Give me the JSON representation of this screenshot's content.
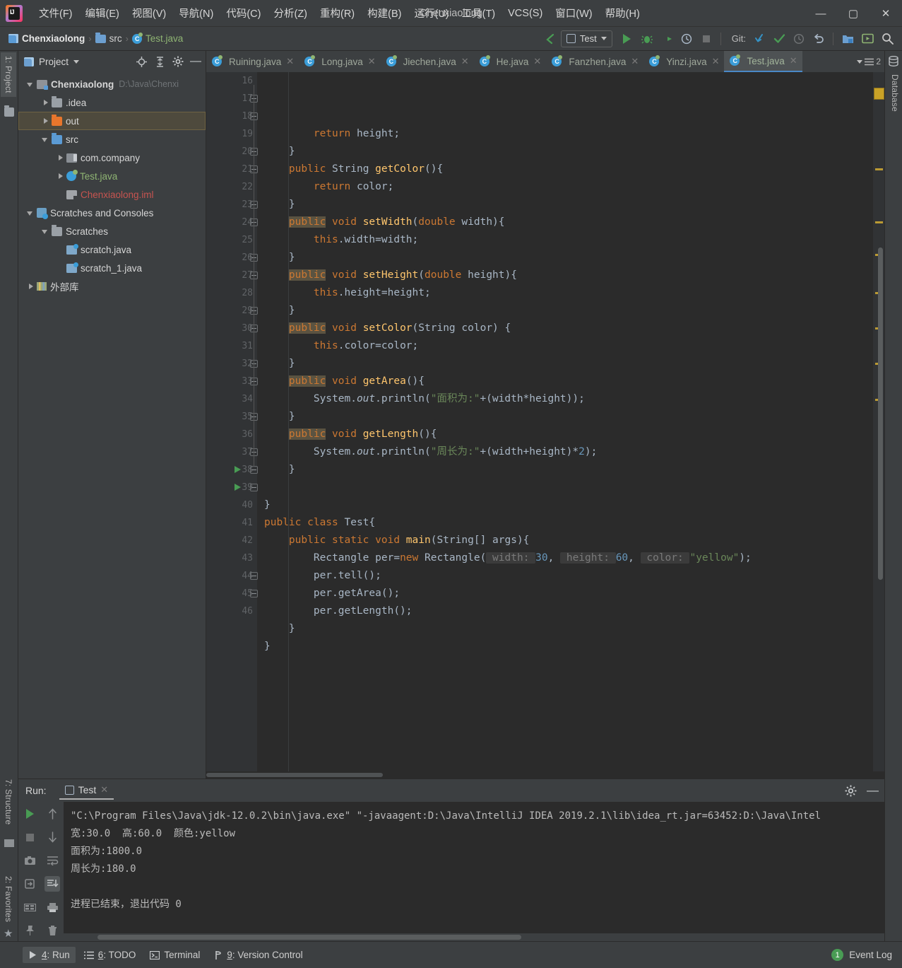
{
  "window": {
    "title": "Chenxiaolong",
    "minimize": "—",
    "maximize": "▢",
    "close": "✕"
  },
  "menu": {
    "items": [
      {
        "label": "文件(F)",
        "name": "menu-file"
      },
      {
        "label": "编辑(E)",
        "name": "menu-edit"
      },
      {
        "label": "视图(V)",
        "name": "menu-view"
      },
      {
        "label": "导航(N)",
        "name": "menu-navigate"
      },
      {
        "label": "代码(C)",
        "name": "menu-code"
      },
      {
        "label": "分析(Z)",
        "name": "menu-analyze"
      },
      {
        "label": "重构(R)",
        "name": "menu-refactor"
      },
      {
        "label": "构建(B)",
        "name": "menu-build"
      },
      {
        "label": "运行(U)",
        "name": "menu-run"
      },
      {
        "label": "工具(T)",
        "name": "menu-tools"
      },
      {
        "label": "VCS(S)",
        "name": "menu-vcs"
      },
      {
        "label": "窗口(W)",
        "name": "menu-window"
      },
      {
        "label": "帮助(H)",
        "name": "menu-help"
      }
    ]
  },
  "navbar": {
    "breadcrumb": [
      "Chenxiaolong",
      "src",
      "Test.java"
    ],
    "separator": "›",
    "run_config": "Test",
    "git_label": "Git:"
  },
  "left_strips": {
    "project": "1: Project",
    "structure": "7: Structure",
    "favorites": "2: Favorites"
  },
  "right_strips": {
    "database": "Database"
  },
  "project_panel": {
    "title": "Project",
    "tree": [
      {
        "label": "Chenxiaolong",
        "path": "D:\\Java\\Chenxi",
        "indent": 0,
        "arrow": "down",
        "icon": "module-icon",
        "bold": true
      },
      {
        "label": ".idea",
        "indent": 1,
        "arrow": "right",
        "icon": "folder-gray-icon"
      },
      {
        "label": "out",
        "indent": 1,
        "arrow": "right",
        "icon": "folder-orange-icon",
        "selected": true
      },
      {
        "label": "src",
        "indent": 1,
        "arrow": "down",
        "icon": "folder-blue-icon"
      },
      {
        "label": "com.company",
        "indent": 2,
        "arrow": "right",
        "icon": "package-icon"
      },
      {
        "label": "Test.java",
        "indent": 2,
        "arrow": "right",
        "icon": "java-class-icon",
        "color": "green"
      },
      {
        "label": "Chenxiaolong.iml",
        "indent": 2,
        "arrow": "none",
        "icon": "iml-icon",
        "color": "red"
      },
      {
        "label": "Scratches and Consoles",
        "indent": 0,
        "arrow": "down",
        "icon": "console-icon"
      },
      {
        "label": "Scratches",
        "indent": 1,
        "arrow": "down",
        "icon": "folder-gray-icon"
      },
      {
        "label": "scratch.java",
        "indent": 2,
        "arrow": "none",
        "icon": "scratch-icon"
      },
      {
        "label": "scratch_1.java",
        "indent": 2,
        "arrow": "none",
        "icon": "scratch-icon"
      },
      {
        "label": "外部库",
        "indent": 0,
        "arrow": "right",
        "icon": "library-icon"
      }
    ]
  },
  "editor": {
    "tabs": [
      {
        "label": "Ruining.java",
        "active": false
      },
      {
        "label": "Long.java",
        "active": false
      },
      {
        "label": "Jiechen.java",
        "active": false
      },
      {
        "label": "He.java",
        "active": false
      },
      {
        "label": "Fanzhen.java",
        "active": false
      },
      {
        "label": "Yinzi.java",
        "active": false
      },
      {
        "label": "Test.java",
        "active": true
      }
    ],
    "tab_overflow_count": "2",
    "first_line_number": 16,
    "last_line_number": 46,
    "lines": [
      {
        "n": 16,
        "fold": "none",
        "run": false,
        "html": "        <span class='kw'>return</span> height;"
      },
      {
        "n": 17,
        "fold": "end",
        "run": false,
        "html": "    }"
      },
      {
        "n": 18,
        "fold": "start",
        "run": false,
        "html": "    <span class='kw'>public</span> <span class='cls'>String</span> <span class='fn'>getColor</span>(){"
      },
      {
        "n": 19,
        "fold": "none",
        "run": false,
        "html": "        <span class='kw'>return</span> color;"
      },
      {
        "n": 20,
        "fold": "end",
        "run": false,
        "html": "    }"
      },
      {
        "n": 21,
        "fold": "start",
        "run": false,
        "html": "    <span class='kwhl'>public</span> <span class='kw'>void</span> <span class='fn'>setWidth</span>(<span class='kw'>double</span> width){"
      },
      {
        "n": 22,
        "fold": "none",
        "run": false,
        "html": "        <span class='kw'>this</span>.width=width;"
      },
      {
        "n": 23,
        "fold": "end",
        "run": false,
        "html": "    }"
      },
      {
        "n": 24,
        "fold": "start",
        "run": false,
        "html": "    <span class='kwhl'>public</span> <span class='kw'>void</span> <span class='fn'>setHeight</span>(<span class='kw'>double</span> height){"
      },
      {
        "n": 25,
        "fold": "none",
        "run": false,
        "html": "        <span class='kw'>this</span>.height=height;"
      },
      {
        "n": 26,
        "fold": "end",
        "run": false,
        "html": "    }"
      },
      {
        "n": 27,
        "fold": "start",
        "run": false,
        "html": "    <span class='kwhl'>public</span> <span class='kw'>void</span> <span class='fn'>setColor</span>(<span class='cls'>String</span> color) {"
      },
      {
        "n": 28,
        "fold": "none",
        "run": false,
        "html": "        <span class='kw'>this</span>.color=color;"
      },
      {
        "n": 29,
        "fold": "end",
        "run": false,
        "html": "    }"
      },
      {
        "n": 30,
        "fold": "start",
        "run": false,
        "html": "    <span class='kwhl'>public</span> <span class='kw'>void</span> <span class='fn'>getArea</span>(){"
      },
      {
        "n": 31,
        "fold": "none",
        "run": false,
        "html": "        System.<span class='stat'>out</span>.println(<span class='str'>\"面积为:\"</span>+(width*height));"
      },
      {
        "n": 32,
        "fold": "end",
        "run": false,
        "html": "    }"
      },
      {
        "n": 33,
        "fold": "start",
        "run": false,
        "html": "    <span class='kwhl'>public</span> <span class='kw'>void</span> <span class='fn'>getLength</span>(){"
      },
      {
        "n": 34,
        "fold": "none",
        "run": false,
        "html": "        System.<span class='stat'>out</span>.println(<span class='str'>\"周长为:\"</span>+(width+height)*<span class='num'>2</span>);"
      },
      {
        "n": 35,
        "fold": "end",
        "run": false,
        "html": "    }"
      },
      {
        "n": 36,
        "fold": "none",
        "run": false,
        "html": ""
      },
      {
        "n": 37,
        "fold": "end",
        "run": false,
        "html": "}"
      },
      {
        "n": 38,
        "fold": "start",
        "run": true,
        "html": "<span class='kw'>public class</span> <span class='cls'>Test</span>{"
      },
      {
        "n": 39,
        "fold": "start",
        "run": true,
        "html": "    <span class='kw'>public static void</span> <span class='fn'>main</span>(<span class='cls'>String</span>[] args){"
      },
      {
        "n": 40,
        "fold": "none",
        "run": false,
        "html": "        <span class='cls'>Rectangle</span> per=<span class='kw'>new</span> <span class='cls'>Rectangle</span>(<span class='hint'> width: </span><span class='num'>30</span>, <span class='hint'> height: </span><span class='num'>60</span>, <span class='hint'> color: </span><span class='str'>\"yellow\"</span>);"
      },
      {
        "n": 41,
        "fold": "none",
        "run": false,
        "html": "        per.tell();"
      },
      {
        "n": 42,
        "fold": "none",
        "run": false,
        "html": "        per.getArea();"
      },
      {
        "n": 43,
        "fold": "none",
        "run": false,
        "html": "        per.getLength();"
      },
      {
        "n": 44,
        "fold": "end",
        "run": false,
        "html": "    }"
      },
      {
        "n": 45,
        "fold": "end",
        "run": false,
        "html": "}"
      },
      {
        "n": 46,
        "fold": "none",
        "run": false,
        "html": ""
      }
    ]
  },
  "run_panel": {
    "label": "Run:",
    "tab": "Test",
    "console_lines": [
      "\"C:\\Program Files\\Java\\jdk-12.0.2\\bin\\java.exe\" \"-javaagent:D:\\Java\\IntelliJ IDEA 2019.2.1\\lib\\idea_rt.jar=63452:D:\\Java\\Intel",
      "宽:30.0  高:60.0  颜色:yellow",
      "面积为:1800.0",
      "周长为:180.0",
      "",
      "进程已结束，退出代码 0"
    ]
  },
  "status_bar": {
    "items": [
      {
        "label": "4: Run",
        "underline": "4",
        "name": "status-run",
        "selected": true
      },
      {
        "label": "6: TODO",
        "underline": "6",
        "name": "status-todo",
        "selected": false
      },
      {
        "label": "Terminal",
        "underline": "",
        "name": "status-terminal",
        "selected": false
      },
      {
        "label": "9: Version Control",
        "underline": "9",
        "name": "status-version-control",
        "selected": false
      }
    ],
    "event_log": "Event Log",
    "event_log_count": "1"
  },
  "colors": {
    "editor_bg": "#2b2b2b",
    "panel_bg": "#3c3f41",
    "gutter_bg": "#313335",
    "accent_blue": "#4a88c7",
    "keyword_orange": "#cc7832",
    "string_green": "#6a8759",
    "number_blue": "#6897bb",
    "method_yellow": "#ffc66d",
    "selection_olive": "#4e4a3d",
    "marker_gold": "#bb9a33",
    "run_green": "#499c54"
  }
}
